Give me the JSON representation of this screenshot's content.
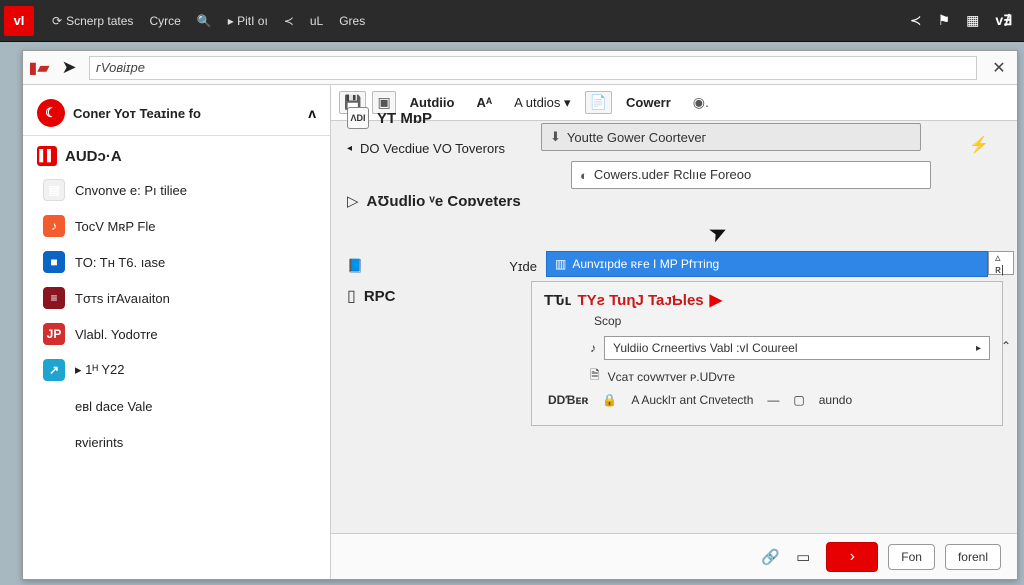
{
  "topbar": {
    "logo_text": "vI",
    "items": [
      {
        "label": "Scnerp tates",
        "icon": "⊕"
      },
      {
        "label": "Cyrce",
        "icon": ""
      },
      {
        "label": "",
        "icon": "🔍"
      },
      {
        "label": "▸  PitI oı",
        "icon": ""
      },
      {
        "label": "≺",
        "icon": ""
      },
      {
        "label": "uL",
        "icon": ""
      },
      {
        "label": "Gres",
        "icon": ""
      }
    ],
    "right": [
      "≺",
      "⚑",
      "▦",
      "v∄"
    ]
  },
  "addressbar": {
    "value": "ᴦVoʙiɪpe"
  },
  "sidebar": {
    "header": "Coner Yoт Teaɪine fo",
    "section": "AUDᴐ·A",
    "items": [
      {
        "label": "Cnvonve e: Pı tiliee"
      },
      {
        "label": "TocV MʀP Fle"
      },
      {
        "label": "TO: Tʜ T6. ıаse"
      },
      {
        "label": "Tσтs iтAvaıaiton"
      },
      {
        "label": "Vlabl. Yodoтre"
      },
      {
        "label": "▸ 1ᴴ Y22"
      },
      {
        "label": "eʙl dace Vale"
      },
      {
        "label": "ʀvierints"
      }
    ]
  },
  "tabs": [
    {
      "label": "Autdiio"
    },
    {
      "label": "Aᴬ"
    },
    {
      "label": "A utdios ▾"
    },
    {
      "label": "Cowerr"
    }
  ],
  "main": {
    "yt_title": "YT MɒP",
    "do_line": "DO Vecdiue VO Toverors",
    "audio_group": "AƱudlio ᵛe Coɒveters",
    "field1": "Youtte Gower Coorteveᴦ",
    "field2": "Cowerѕ.udeꜰ Rclııe Foreoo",
    "bluebar": "Aunvɪıpde ʀꜰe I MP Pfттing",
    "bluebar_right": "▵ ʀ|",
    "rpc": "RPC",
    "yside_label": "Yɪde"
  },
  "panel": {
    "title_black": "TԎʟ",
    "title_red": "TYƨ TuɳJ TaᴊƄles",
    "scop": "Scop",
    "row1": "Yuldiio Cɾneertivs Vabl :vI Coɯreel",
    "row2": "Vcaт covwтver ᴘ.UDvтe",
    "row3_a": "DDƁᴇʀ",
    "row3_b": "A Aucklт ant Cпvetecth",
    "row3_c": "aundo"
  },
  "footer": {
    "btn1": "Fon",
    "btn2": "forenl"
  }
}
